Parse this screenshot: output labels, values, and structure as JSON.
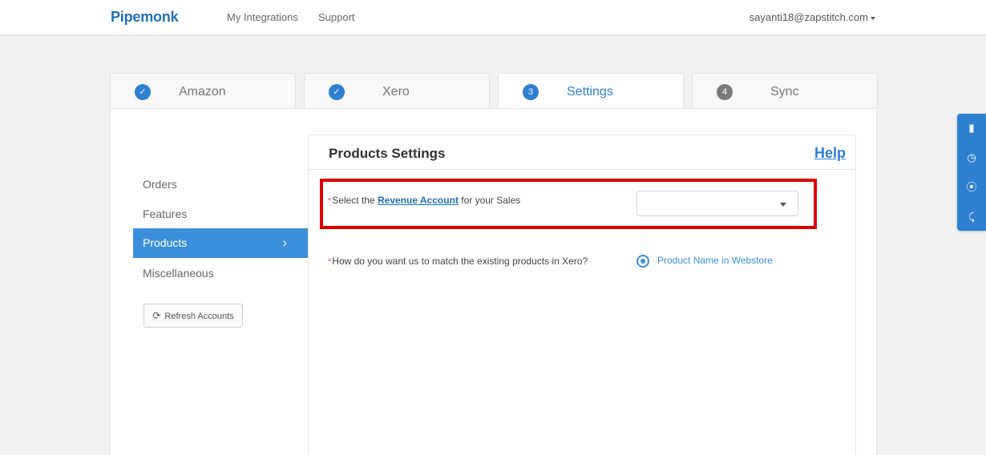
{
  "nav": {
    "logo": "Pipemonk",
    "links": [
      "My Integrations",
      "Support"
    ],
    "user": "sayanti18@zapstitch.com"
  },
  "steps": [
    {
      "badge": "✓",
      "label": "Amazon",
      "state": "done"
    },
    {
      "badge": "✓",
      "label": "Xero",
      "state": "done"
    },
    {
      "badge": "3",
      "label": "Settings",
      "state": "active"
    },
    {
      "badge": "4",
      "label": "Sync",
      "state": "pending"
    }
  ],
  "sidebar": {
    "items": [
      "Orders",
      "Features",
      "Products",
      "Miscellaneous"
    ],
    "active": "Products",
    "refresh_label": "Refresh Accounts"
  },
  "panel": {
    "title": "Products Settings",
    "help": "Help",
    "q1": {
      "required_mark": "*",
      "prefix": "Select the ",
      "link": "Revenue Account",
      "suffix": " for your Sales",
      "selected_value": ""
    },
    "q2": {
      "required_mark": "*",
      "text": "How do you want us to match the existing products in Xero?",
      "option": "Product Name in Webstore"
    }
  },
  "float_toolbar": {
    "icons": [
      "book-icon",
      "clock-icon",
      "lifebuoy-icon",
      "rss-icon"
    ]
  },
  "colors": {
    "brand": "#1e6fb8",
    "accent": "#3b8ed9",
    "highlight": "#e00000"
  }
}
